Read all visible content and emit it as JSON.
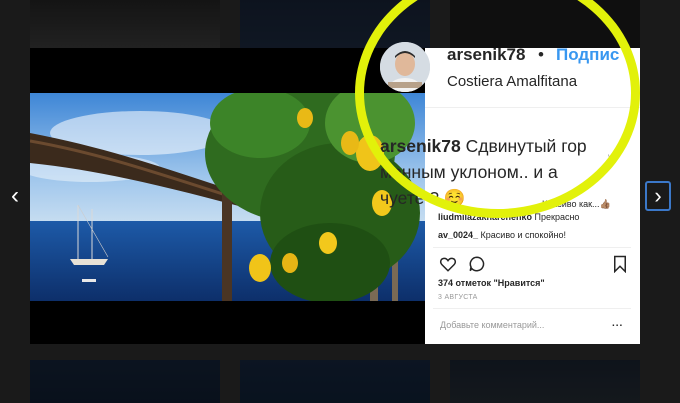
{
  "post": {
    "username": "arsenik78",
    "separator": "•",
    "follow_label": "Подпис",
    "location": "Costiera Amalfitana",
    "caption_user": "arsenik78",
    "caption_line1": " Сдвинутый гор",
    "caption_line2": "монным уклоном.. и а",
    "caption_line3": "чуете ? ☺️",
    "caption_tiny": "vel",
    "comments": [
      {
        "user": "liudmilazakharchenko",
        "text": " Прекрасно"
      },
      {
        "user": "av_0024_",
        "text": " Красиво и спокойно!"
      }
    ],
    "likes": "374 отметок \"Нравится\"",
    "date": "3 АВГУСТА",
    "add_comment_placeholder": "Добавьте комментарий...",
    "more_label": "..."
  },
  "nav": {
    "prev_label": "‹",
    "next_label": "›"
  },
  "overlay_tooltip": "Красиво как...👍🏽",
  "colors": {
    "highlight": "#e2f10a",
    "follow": "#3897f0",
    "nav_border": "#3b78c9"
  }
}
